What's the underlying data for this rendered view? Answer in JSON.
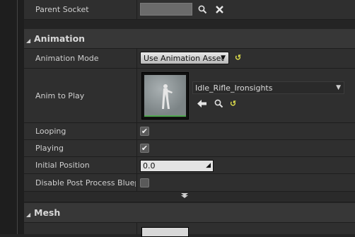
{
  "properties_top": {
    "parent_socket_label": "Parent Socket"
  },
  "animation_category": {
    "title": "Animation",
    "mode_label": "Animation Mode",
    "mode_value": "Use Animation Asset",
    "anim_to_play_label": "Anim to Play",
    "anim_asset_name": "Idle_Rifle_Ironsights",
    "looping_label": "Looping",
    "looping_checked": true,
    "playing_label": "Playing",
    "playing_checked": true,
    "initial_position_label": "Initial Position",
    "initial_position_value": "0.0",
    "disable_post_process_label": "Disable Post Process Blueprint",
    "disable_post_process_checked": false
  },
  "mesh_category": {
    "title": "Mesh"
  },
  "icons": {
    "search": "search-icon",
    "clear": "close-icon",
    "reset": "reset-arrow-icon",
    "use_selected": "arrow-left-icon",
    "collapse": "triangle-down-icon",
    "expand_more": "triangle-down-icon"
  },
  "colors": {
    "background": "#242424",
    "row": "#2f2f2f",
    "category": "#373737",
    "reset_icon": "#e5e54d",
    "thumb_strip": "#4fa64f"
  }
}
